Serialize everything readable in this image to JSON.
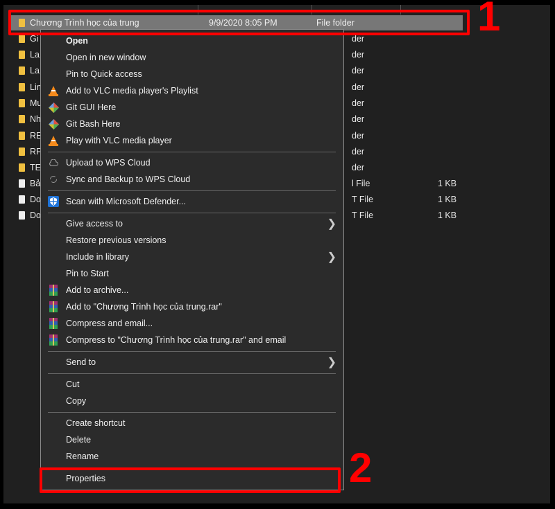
{
  "files": [
    {
      "name": "Chương Trình học của trung",
      "date": "9/9/2020 8:05 PM",
      "type": "File folder",
      "size": "",
      "icon": "folder-icon",
      "selected": true
    },
    {
      "name": "Gi",
      "date": "",
      "type": "der",
      "size": "",
      "icon": "folder-icon"
    },
    {
      "name": "La",
      "date": "",
      "type": "der",
      "size": "",
      "icon": "folder-icon"
    },
    {
      "name": "La",
      "date": "",
      "type": "der",
      "size": "",
      "icon": "folder-icon"
    },
    {
      "name": "Lin",
      "date": "",
      "type": "der",
      "size": "",
      "icon": "folder-icon"
    },
    {
      "name": "Mu",
      "date": "",
      "type": "der",
      "size": "",
      "icon": "folder-icon"
    },
    {
      "name": "Nh",
      "date": "",
      "type": "der",
      "size": "",
      "icon": "folder-icon"
    },
    {
      "name": "RE",
      "date": "",
      "type": "der",
      "size": "",
      "icon": "folder-icon"
    },
    {
      "name": "RF",
      "date": "",
      "type": "der",
      "size": "",
      "icon": "folder-icon"
    },
    {
      "name": "TE",
      "date": "",
      "type": "der",
      "size": "",
      "icon": "folder-icon"
    },
    {
      "name": "Bả",
      "date": "",
      "type": "l File",
      "size": "1 KB",
      "icon": "file-icon"
    },
    {
      "name": "Do",
      "date": "",
      "type": "T File",
      "size": "1 KB",
      "icon": "file-icon"
    },
    {
      "name": "Do",
      "date": "",
      "type": "T File",
      "size": "1 KB",
      "icon": "file-icon"
    }
  ],
  "menu": [
    {
      "label": "Open",
      "bold": true
    },
    {
      "label": "Open in new window"
    },
    {
      "label": "Pin to Quick access"
    },
    {
      "label": "Add to VLC media player's Playlist",
      "icon": "vlc-icon"
    },
    {
      "label": "Git GUI Here",
      "icon": "git-icon"
    },
    {
      "label": "Git Bash Here",
      "icon": "git-icon"
    },
    {
      "label": "Play with VLC media player",
      "icon": "vlc-icon"
    },
    {
      "sep": true
    },
    {
      "label": "Upload to WPS Cloud",
      "icon": "cloud-icon"
    },
    {
      "label": "Sync and Backup to WPS Cloud",
      "icon": "sync-icon"
    },
    {
      "sep": true
    },
    {
      "label": "Scan with Microsoft Defender...",
      "icon": "defender-shield-icon"
    },
    {
      "sep": true
    },
    {
      "label": "Give access to",
      "submenu": true
    },
    {
      "label": "Restore previous versions"
    },
    {
      "label": "Include in library",
      "submenu": true
    },
    {
      "label": "Pin to Start"
    },
    {
      "label": "Add to archive...",
      "icon": "winrar-icon"
    },
    {
      "label": "Add to \"Chương Trình học của trung.rar\"",
      "icon": "winrar-icon"
    },
    {
      "label": "Compress and email...",
      "icon": "winrar-icon"
    },
    {
      "label": "Compress to \"Chương Trình học của trung.rar\" and email",
      "icon": "winrar-icon"
    },
    {
      "sep": true
    },
    {
      "label": "Send to",
      "submenu": true
    },
    {
      "sep": true
    },
    {
      "label": "Cut"
    },
    {
      "label": "Copy"
    },
    {
      "sep": true
    },
    {
      "label": "Create shortcut"
    },
    {
      "label": "Delete"
    },
    {
      "label": "Rename"
    },
    {
      "sep": true
    },
    {
      "label": "Properties",
      "highlight": true
    }
  ],
  "annotations": {
    "step1": "1",
    "step2": "2",
    "color": "#ff0000"
  }
}
